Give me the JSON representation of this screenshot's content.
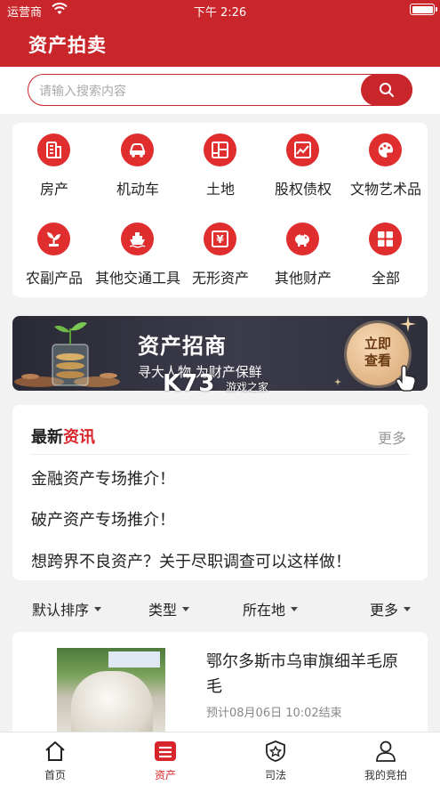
{
  "status_bar": {
    "carrier": "运营商",
    "time": "下午 2:26"
  },
  "header": {
    "title": "资产拍卖"
  },
  "search": {
    "placeholder": "请输入搜索内容"
  },
  "categories": [
    {
      "label": "房产",
      "icon": "building-icon"
    },
    {
      "label": "机动车",
      "icon": "car-icon"
    },
    {
      "label": "土地",
      "icon": "land-grid-icon"
    },
    {
      "label": "股权债权",
      "icon": "chart-icon"
    },
    {
      "label": "文物艺术品",
      "icon": "palette-icon"
    },
    {
      "label": "农副产品",
      "icon": "plant-icon"
    },
    {
      "label": "其他交通工具",
      "icon": "ship-icon"
    },
    {
      "label": "无形资产",
      "icon": "yen-icon"
    },
    {
      "label": "其他财产",
      "icon": "piggy-bank-icon"
    },
    {
      "label": "全部",
      "icon": "grid-icon"
    }
  ],
  "banner": {
    "title": "资产招商",
    "subtitle": "寻大人物 为财产保鲜",
    "cta": "立即查看",
    "watermark": "K73",
    "watermark_sub": "游戏之家"
  },
  "news": {
    "heading_part1": "最新",
    "heading_part2": "资讯",
    "more": "更多",
    "items": [
      "金融资产专场推介！",
      "破产资产专场推介！",
      "想跨界不良资产？关于尽职调查可以这样做！"
    ]
  },
  "filters": [
    "默认排序",
    "类型",
    "所在地",
    "更多"
  ],
  "listing": {
    "title": "鄂尔多斯市乌审旗细羊毛原毛",
    "meta": "预计08月06日 10:02结束"
  },
  "tabs": [
    {
      "label": "首页",
      "icon": "home-icon"
    },
    {
      "label": "资产",
      "icon": "asset-list-icon",
      "active": true
    },
    {
      "label": "司法",
      "icon": "judicial-badge-icon"
    },
    {
      "label": "我的竞拍",
      "icon": "user-icon"
    }
  ],
  "colors": {
    "brand": "#c8262a",
    "accent": "#e02d2d"
  }
}
